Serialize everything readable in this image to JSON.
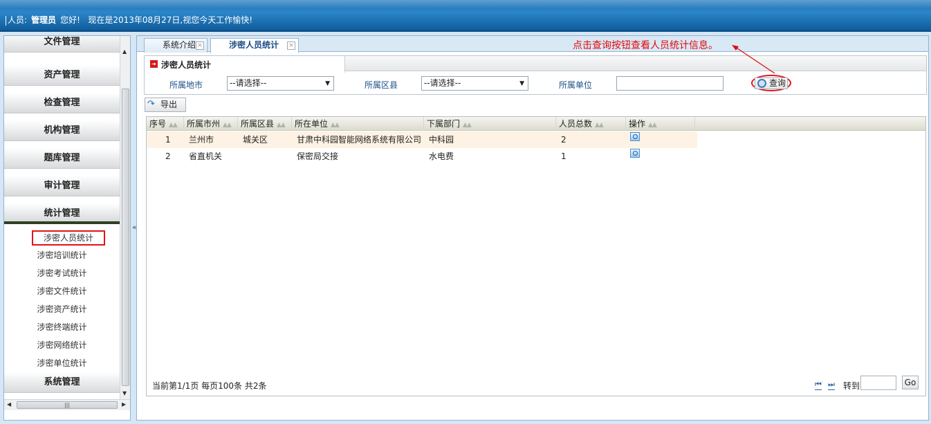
{
  "header": {
    "user_prefix": "人员:",
    "user_name": "管理员",
    "greeting": "您好!",
    "date_message": "现在是2013年08月27日,视您今天工作愉快!"
  },
  "sidebar": {
    "menus": [
      {
        "label": "文件管理"
      },
      {
        "label": "资产管理"
      },
      {
        "label": "检查管理"
      },
      {
        "label": "机构管理"
      },
      {
        "label": "题库管理"
      },
      {
        "label": "审计管理"
      },
      {
        "label": "统计管理"
      }
    ],
    "submenu": [
      {
        "label": "涉密人员统计",
        "selected": true
      },
      {
        "label": "涉密培训统计"
      },
      {
        "label": "涉密考试统计"
      },
      {
        "label": "涉密文件统计"
      },
      {
        "label": "涉密资产统计"
      },
      {
        "label": "涉密终端统计"
      },
      {
        "label": "涉密网络统计"
      },
      {
        "label": "涉密单位统计"
      }
    ],
    "bottom_menu": {
      "label": "系统管理"
    },
    "splitter_glyph": "«"
  },
  "tabs": [
    {
      "label": "系统介绍",
      "active": false
    },
    {
      "label": "涉密人员统计",
      "active": true
    }
  ],
  "annotation": {
    "text": "点击查询按钮查看人员统计信息。",
    "color": "#e10a0a"
  },
  "panel": {
    "title": "涉密人员统计",
    "filters": {
      "city_label": "所属地市",
      "city_value": "--请选择--",
      "district_label": "所属区县",
      "district_value": "--请选择--",
      "unit_label": "所属单位",
      "unit_value": ""
    },
    "query_button": "查询"
  },
  "toolbar": {
    "export_label": "导出"
  },
  "table": {
    "columns": [
      "序号",
      "所属市州",
      "所属区县",
      "所在单位",
      "下属部门",
      "人员总数",
      "操作"
    ],
    "rows": [
      {
        "index": "1",
        "city": "兰州市",
        "district": "城关区",
        "unit": "甘肃中科园智能网络系统有限公司",
        "department": "中科园",
        "total": "2"
      },
      {
        "index": "2",
        "city": "省直机关",
        "district": "",
        "unit": "保密局交接",
        "department": "水电费",
        "total": "1"
      }
    ]
  },
  "pagination": {
    "info": "当前第1/1页 每页100条 共2条",
    "goto_label": "转到",
    "go_button": "Go"
  },
  "colors": {
    "accent_blue": "#2b86c9",
    "highlight_red": "#e0131a",
    "row_alt": "#fdf2e3"
  }
}
